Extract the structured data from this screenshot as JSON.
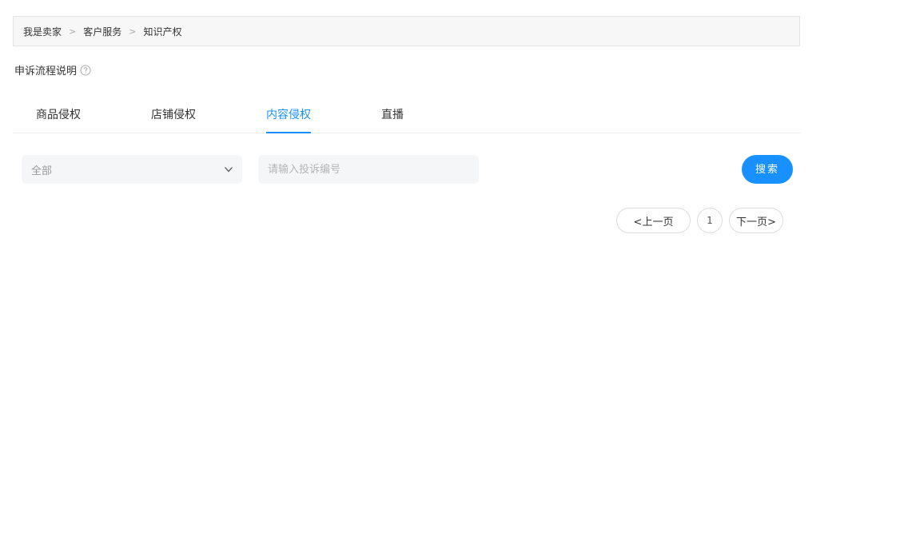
{
  "breadcrumb": {
    "items": [
      "我是卖家",
      "客户服务",
      "知识产权"
    ],
    "separator": ">"
  },
  "appeal": {
    "label": "申诉流程说明",
    "icon": "help-circle-icon"
  },
  "tabs": [
    {
      "label": "商品侵权",
      "active": false
    },
    {
      "label": "店铺侵权",
      "active": false
    },
    {
      "label": "内容侵权",
      "active": true
    },
    {
      "label": "直播",
      "active": false
    }
  ],
  "filters": {
    "status_select": {
      "value": "全部",
      "icon": "chevron-down-icon"
    },
    "complaint_input": {
      "value": "",
      "placeholder": "请输入投诉编号"
    },
    "search_label": "搜索"
  },
  "pagination": {
    "prev_label": "<上一页",
    "current_page": "1",
    "next_label": "下一页>"
  },
  "colors": {
    "accent": "#1890ff",
    "input_bg": "#f5f6f8",
    "breadcrumb_bg": "#f7f7f7"
  }
}
